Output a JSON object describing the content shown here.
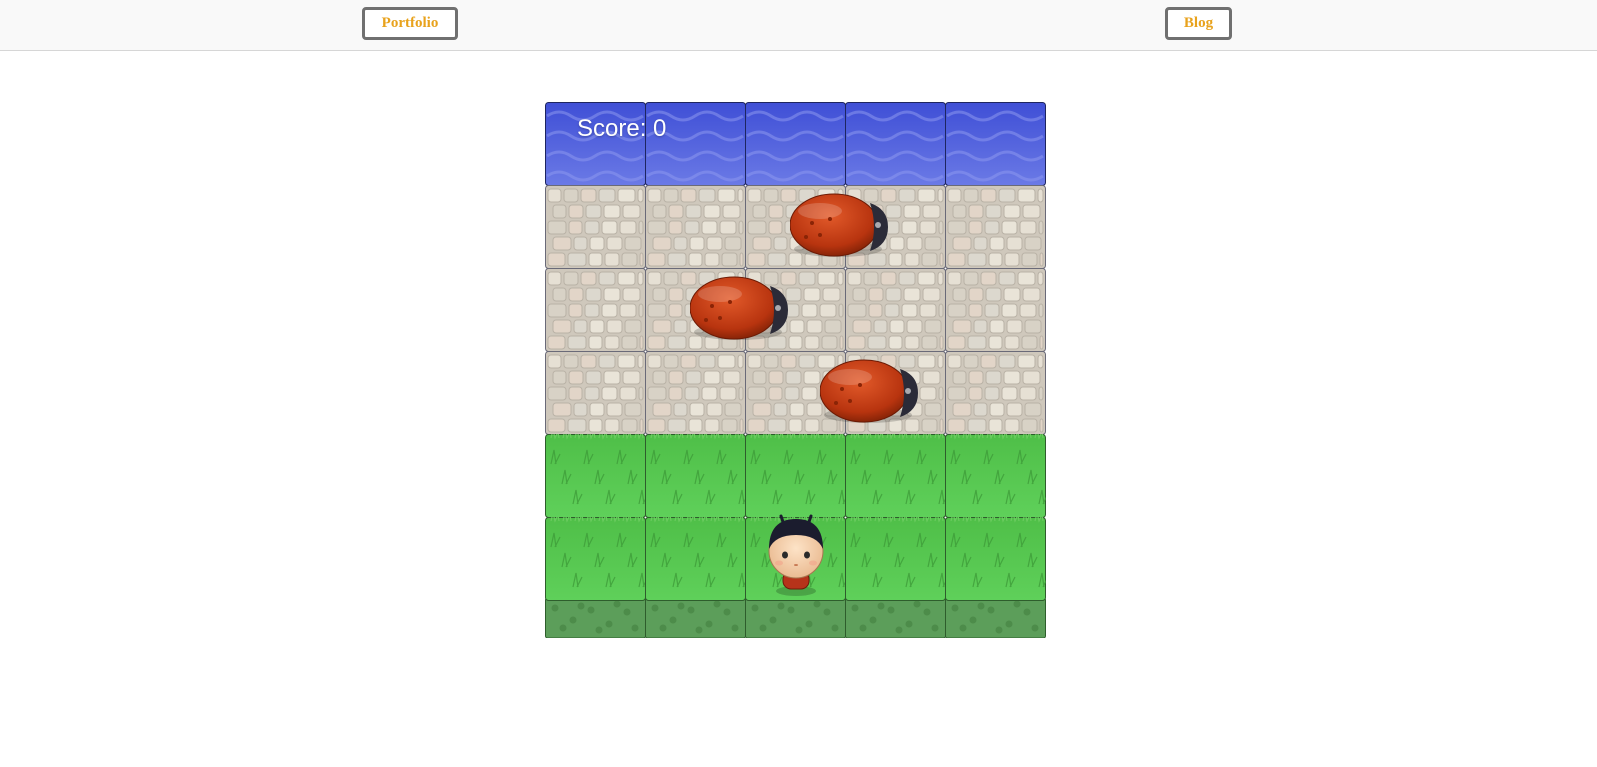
{
  "nav": {
    "portfolio_label": "Portfolio",
    "blog_label": "Blog"
  },
  "game": {
    "score_label": "Score:",
    "score_value": "0",
    "score_text": "Score: 0",
    "rows": [
      "water",
      "stone",
      "stone",
      "stone",
      "grass",
      "grass"
    ],
    "columns": 5,
    "enemies": [
      {
        "type": "enemy-bug",
        "row": 1,
        "col": 2.5
      },
      {
        "type": "enemy-bug",
        "row": 2,
        "col": 1.5
      },
      {
        "type": "enemy-bug",
        "row": 3,
        "col": 2.8
      }
    ],
    "player": {
      "type": "char-boy",
      "row": 5,
      "col": 2
    },
    "colors": {
      "accent": "#e8a21c",
      "water": "#5161dc",
      "stone": "#d9d2c6",
      "grass": "#52c44e",
      "dirt": "#5e9e5a",
      "bug": "#c03a14"
    }
  }
}
